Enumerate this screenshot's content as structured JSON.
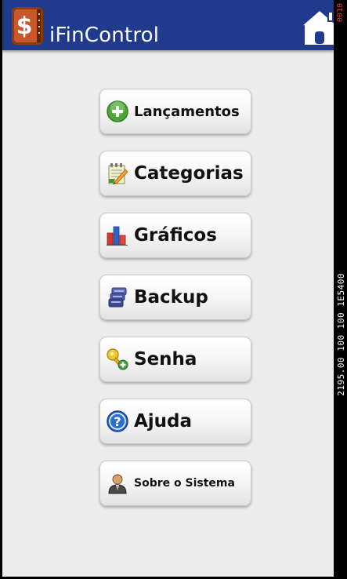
{
  "app": {
    "title": "iFinControl"
  },
  "menu": {
    "items": [
      {
        "id": "lancamentos",
        "label": "Lançamentos",
        "icon": "plus-circle-icon"
      },
      {
        "id": "categorias",
        "label": "Categorias",
        "icon": "notepad-pencil-icon"
      },
      {
        "id": "graficos",
        "label": "Gráficos",
        "icon": "bar-chart-icon"
      },
      {
        "id": "backup",
        "label": "Backup",
        "icon": "database-icon"
      },
      {
        "id": "senha",
        "label": "Senha",
        "icon": "key-icon"
      },
      {
        "id": "ajuda",
        "label": "Ajuda",
        "icon": "help-icon"
      },
      {
        "id": "sobre",
        "label": "Sobre o Sistema",
        "icon": "user-icon"
      }
    ]
  },
  "status": {
    "readout": "2195.00 100 100 1E5400",
    "time": "0010"
  },
  "colors": {
    "header": "#203a8c",
    "background": "#ececec",
    "accent_red": "#e03a2f"
  }
}
